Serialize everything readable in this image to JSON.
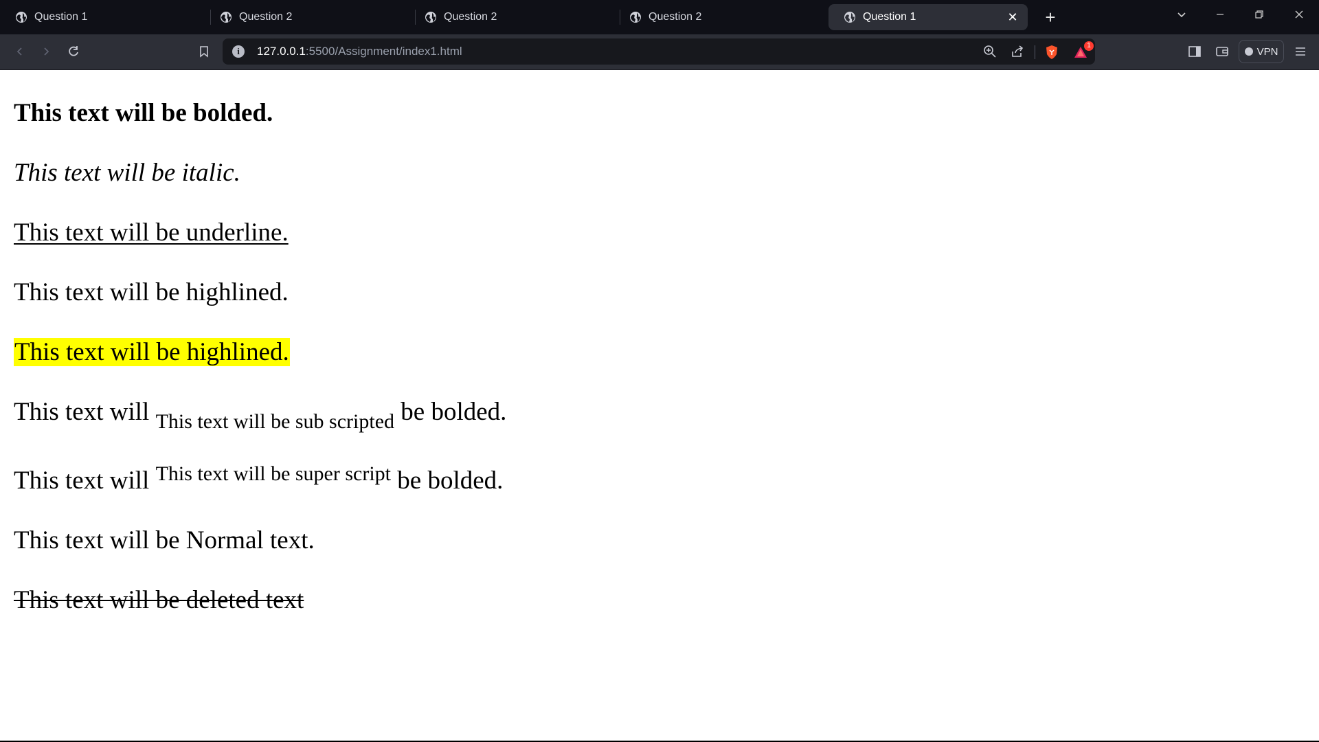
{
  "tabs": [
    {
      "title": "Question 1",
      "active": false
    },
    {
      "title": "Question 2",
      "active": false
    },
    {
      "title": "Question 2",
      "active": false
    },
    {
      "title": "Question 2",
      "active": false
    },
    {
      "title": "Question 1",
      "active": true
    }
  ],
  "toolbar": {
    "url_host": "127.0.0.1",
    "url_rest": ":5500/Assignment/index1.html",
    "vpn_label": "VPN",
    "rewards_badge": "1"
  },
  "content": {
    "bold": "This text will be bolded.",
    "italic": "This text will be italic.",
    "underline": "This text will be underline.",
    "plain_highlight": "This text will be highlined.",
    "marked": "This text will be highlined.",
    "sub_before": "This text will ",
    "sub_text": "This text will be sub scripted",
    "sub_after": " be bolded.",
    "sup_before": "This text will ",
    "sup_text": "This text will be super script",
    "sup_after": " be bolded.",
    "normal": "This text will be Normal text.",
    "deleted": "This text will be deleted text"
  }
}
